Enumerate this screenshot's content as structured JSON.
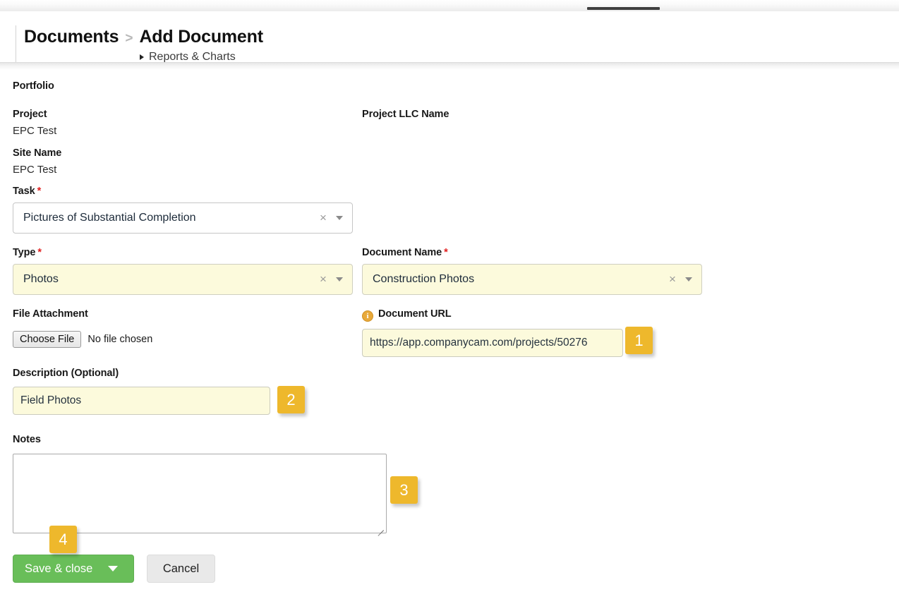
{
  "window": {
    "tab_indicator": ""
  },
  "breadcrumb": {
    "root": "Documents",
    "separator": ">",
    "current": "Add Document",
    "sub_item": "Reports & Charts"
  },
  "form": {
    "portfolio": {
      "label": "Portfolio",
      "value": ""
    },
    "project": {
      "label": "Project",
      "value": "EPC Test"
    },
    "project_llc_name": {
      "label": "Project LLC Name",
      "value": ""
    },
    "site_name": {
      "label": "Site Name",
      "value": "EPC Test"
    },
    "task": {
      "label": "Task",
      "required": "*",
      "value": "Pictures of Substantial Completion",
      "clear_icon": "×",
      "caret_icon": "chevron-down-icon"
    },
    "type": {
      "label": "Type",
      "required": "*",
      "value": "Photos",
      "clear_icon": "×",
      "caret_icon": "chevron-down-icon"
    },
    "document_name": {
      "label": "Document Name",
      "required": "*",
      "value": "Construction Photos",
      "clear_icon": "×",
      "caret_icon": "chevron-down-icon"
    },
    "file_attachment": {
      "label": "File Attachment",
      "button_label": "Choose File",
      "status": "No file chosen"
    },
    "document_url": {
      "label": "Document URL",
      "info_icon": "info-icon",
      "info_glyph": "i",
      "value": "https://app.companycam.com/projects/50276"
    },
    "description": {
      "label": "Description (Optional)",
      "value": "Field Photos"
    },
    "notes": {
      "label": "Notes",
      "value": ""
    }
  },
  "actions": {
    "save_label": "Save & close",
    "cancel_label": "Cancel"
  },
  "annotations": [
    {
      "number": "1"
    },
    {
      "number": "2"
    },
    {
      "number": "3"
    },
    {
      "number": "4"
    }
  ],
  "colors": {
    "badge": "#eeb82c",
    "save_button": "#69be59",
    "highlight_field": "#fcfadc",
    "required_asterisk": "#e02020",
    "info_icon": "#e8a93a"
  }
}
